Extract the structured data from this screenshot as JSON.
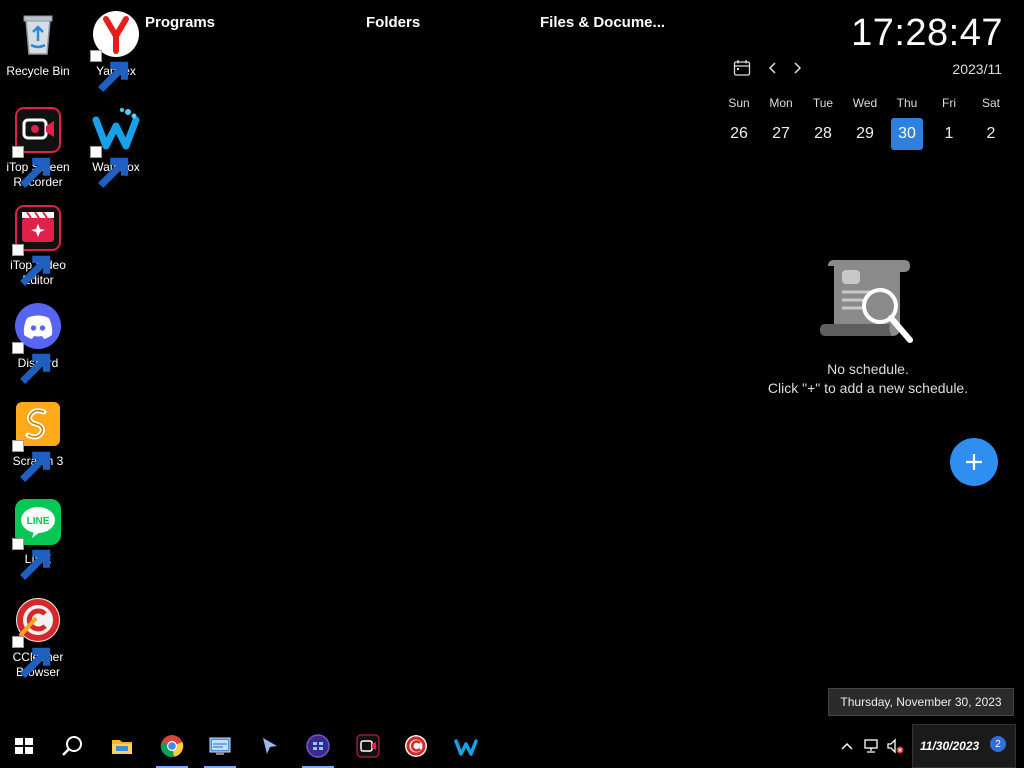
{
  "desktop": {
    "icons": [
      {
        "label": "Recycle Bin",
        "icon": "recycle-bin-icon"
      },
      {
        "label": "Yandex",
        "icon": "yandex-icon"
      },
      {
        "label": "iTop Screen Recorder",
        "icon": "itop-screen-recorder-icon"
      },
      {
        "label": "Waterfox",
        "icon": "waterfox-icon"
      },
      {
        "label": "iTop Video Editor",
        "icon": "itop-video-editor-icon"
      },
      {
        "label": "Discord",
        "icon": "discord-icon"
      },
      {
        "label": "Scratch 3",
        "icon": "scratch-icon"
      },
      {
        "label": "LINE",
        "icon": "line-icon"
      },
      {
        "label": "CCleaner Browser",
        "icon": "ccleaner-icon"
      }
    ]
  },
  "fences": {
    "programs": "Programs",
    "folders": "Folders",
    "files": "Files & Docume..."
  },
  "widget": {
    "clock": "17:28:47",
    "month": "2023/11",
    "weekdays": [
      "Sun",
      "Mon",
      "Tue",
      "Wed",
      "Thu",
      "Fri",
      "Sat"
    ],
    "days": [
      "26",
      "27",
      "28",
      "29",
      "30",
      "1",
      "2"
    ],
    "today": "30",
    "empty_line1": "No schedule.",
    "empty_line2": "Click \"+\" to add a new schedule.",
    "add_label": "+",
    "accent": "#2f8ff0"
  },
  "tooltip": "Thursday, November 30, 2023",
  "taskbar": {
    "apps": [
      "start-icon",
      "search-icon",
      "file-explorer-icon",
      "chrome-icon",
      "control-panel-icon",
      "cursor-app-icon",
      "windows-app-icon",
      "itop-screen-recorder-icon",
      "ccleaner-icon",
      "waterfox-icon"
    ],
    "date": "11/30/2023",
    "notification_count": "2"
  }
}
